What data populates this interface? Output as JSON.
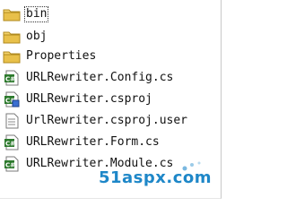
{
  "tree": {
    "items": [
      {
        "label": "bin",
        "icon": "folder-icon",
        "selected": true
      },
      {
        "label": "obj",
        "icon": "folder-icon"
      },
      {
        "label": "Properties",
        "icon": "folder-icon"
      },
      {
        "label": "URLRewriter.Config.cs",
        "icon": "csharp-file-icon"
      },
      {
        "label": "URLRewriter.csproj",
        "icon": "csproj-file-icon"
      },
      {
        "label": "UrlRewriter.csproj.user",
        "icon": "csproj-user-file-icon"
      },
      {
        "label": "URLRewriter.Form.cs",
        "icon": "csharp-file-icon"
      },
      {
        "label": "URLRewriter.Module.cs",
        "icon": "csharp-file-icon"
      }
    ]
  },
  "watermark": {
    "text": "51aspx.com"
  },
  "colors": {
    "folder": "#e8c04a",
    "csharp": "#2d7a2d",
    "accent": "#1e87c8"
  }
}
